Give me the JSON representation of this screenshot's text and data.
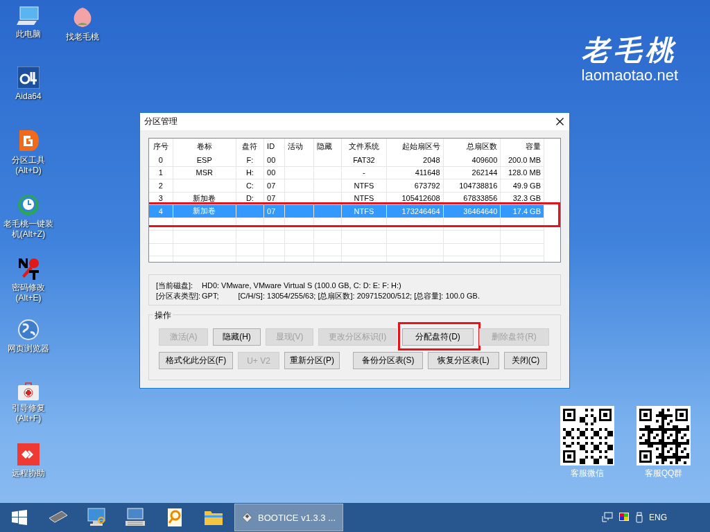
{
  "desktop_icons": [
    {
      "lines": [
        "此电脑"
      ]
    },
    {
      "lines": [
        "找老毛桃"
      ]
    },
    {
      "lines": [
        "Aida64"
      ]
    },
    {
      "lines": [
        "分区工具",
        "(Alt+D)"
      ]
    },
    {
      "lines": [
        "老毛桃一键装",
        "机(Alt+Z)"
      ]
    },
    {
      "lines": [
        "密码修改",
        "(Alt+E)"
      ]
    },
    {
      "lines": [
        "网页浏览器"
      ]
    },
    {
      "lines": [
        "引导修复",
        "(Alt+F)"
      ]
    },
    {
      "lines": [
        "远程协助"
      ]
    }
  ],
  "logo": {
    "mark": "老毛桃",
    "site": "laomaotao.net"
  },
  "qr_codes": [
    {
      "caption": "客服微信"
    },
    {
      "caption": "客服QQ群"
    }
  ],
  "window": {
    "title": "分区管理",
    "table": {
      "columns": [
        "序号",
        "卷标",
        "盘符",
        "ID",
        "活动",
        "隐藏",
        "文件系统",
        "起始扇区号",
        "总扇区数",
        "容量"
      ],
      "rows": [
        {
          "cells": [
            "0",
            "ESP",
            "F:",
            "00",
            null,
            null,
            "FAT32",
            "2048",
            "409600",
            "200.0 MB"
          ],
          "selected": false,
          "highlighted": false
        },
        {
          "cells": [
            "1",
            "MSR",
            "H:",
            "00",
            null,
            null,
            "-",
            "411648",
            "262144",
            "128.0 MB"
          ],
          "selected": false,
          "highlighted": false
        },
        {
          "cells": [
            "2",
            null,
            "C:",
            "07",
            null,
            null,
            "NTFS",
            "673792",
            "104738816",
            "49.9 GB"
          ],
          "selected": false,
          "highlighted": false
        },
        {
          "cells": [
            "3",
            "新加卷",
            "D:",
            "07",
            null,
            null,
            "NTFS",
            "105412608",
            "67833856",
            "32.3 GB"
          ],
          "selected": false,
          "highlighted": false
        },
        {
          "cells": [
            "4",
            "新加卷",
            null,
            "07",
            null,
            null,
            "NTFS",
            "173246464",
            "36464640",
            "17.4 GB"
          ],
          "selected": true,
          "highlighted": true
        }
      ]
    },
    "info": [
      {
        "label": "[当前磁盘]:",
        "value": "HD0: VMware, VMware Virtual S (100.0 GB, C: D: E: F: H:)"
      },
      {
        "label": "[分区表类型]:",
        "value": "GPT;",
        "extra": "[C/H/S]: 13054/255/63; [总扇区数]: 209715200/512; [总容量]: 100.0 GB."
      }
    ],
    "group_title": "操作",
    "button_rows": [
      [
        {
          "label": "激活(A)",
          "disabled": true,
          "highlighted": false
        },
        {
          "label": "隐藏(H)",
          "disabled": false,
          "highlighted": false
        },
        {
          "label": "显现(V)",
          "disabled": true,
          "highlighted": false
        },
        {
          "label": "更改分区标识(I)",
          "disabled": true,
          "highlighted": false
        },
        {
          "label": "分配盘符(D)",
          "disabled": false,
          "highlighted": true
        },
        {
          "label": "删除盘符(R)",
          "disabled": true,
          "highlighted": false
        }
      ],
      [
        {
          "label": "格式化此分区(F)",
          "disabled": false,
          "highlighted": false
        },
        {
          "label": "U+ V2",
          "disabled": true,
          "highlighted": false
        },
        {
          "label": "重新分区(P)",
          "disabled": false,
          "highlighted": false
        },
        {
          "label": "备份分区表(S)",
          "disabled": false,
          "highlighted": false
        },
        {
          "label": "恢复分区表(L)",
          "disabled": false,
          "highlighted": false
        },
        {
          "label": "关闭(C)",
          "disabled": false,
          "highlighted": false
        }
      ]
    ]
  },
  "taskbar": {
    "active_app": {
      "label": "BOOTICE v1.3.3 ...",
      "selected": true
    },
    "language": "ENG"
  }
}
